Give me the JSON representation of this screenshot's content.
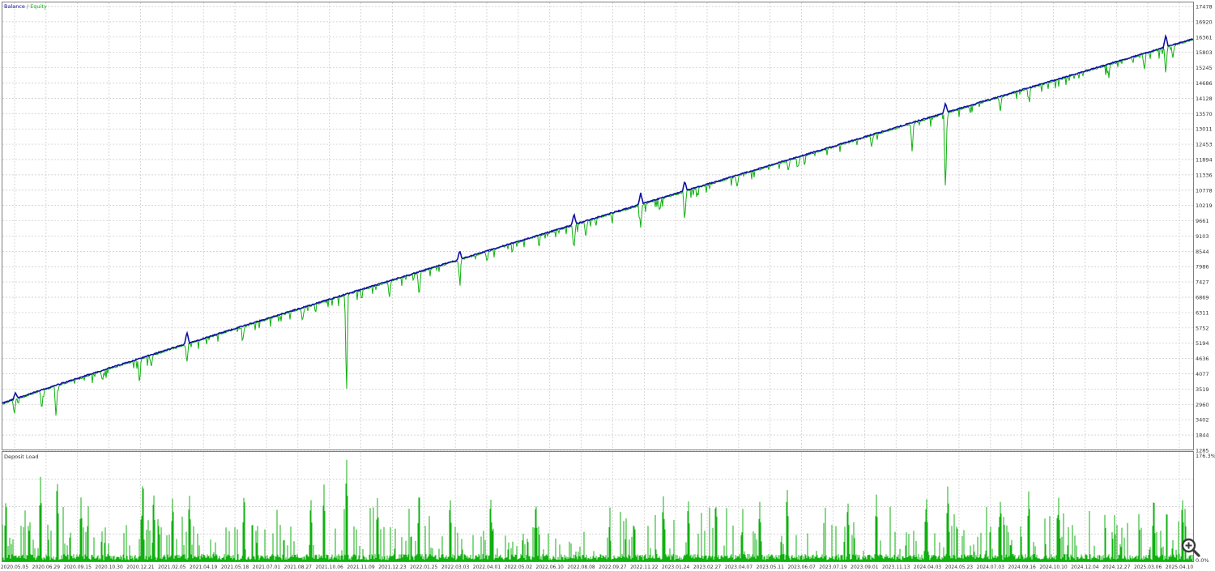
{
  "chart_data": [
    {
      "type": "line",
      "legend": {
        "label_prefix": "Balance",
        "label_separator": " / ",
        "label_suffix": "Equity",
        "placement": "top-left"
      },
      "colors": {
        "balance": "#1010a0",
        "equity": "#10b010",
        "grid": "#c8c8c8",
        "frame": "#7f7f7f",
        "text": "#333333"
      },
      "grid": true,
      "ylim": [
        1285,
        17478
      ],
      "y_ticks": [
        "17478",
        "16920",
        "16361",
        "15803",
        "15245",
        "14686",
        "14128",
        "13570",
        "13011",
        "12453",
        "11894",
        "11336",
        "10778",
        "10219",
        "9661",
        "9103",
        "8544",
        "7986",
        "7427",
        "6869",
        "6311",
        "5752",
        "5194",
        "4636",
        "4077",
        "3519",
        "2960",
        "3402",
        "1844",
        "1285"
      ],
      "x_labels": [
        "2020.05.05",
        "2020.06.29",
        "2020.09.15",
        "2020.10.30",
        "2020.12.21",
        "2021.02.05",
        "2021.04.19",
        "2021.05.18",
        "2021.07.01",
        "2021.08.27",
        "2021.10.06",
        "2021.11.09",
        "2021.12.23",
        "2022.01.25",
        "2022.03.03",
        "2022.04.01",
        "2022.05.02",
        "2022.06.10",
        "2022.08.08",
        "2022.09.27",
        "2022.11.22",
        "2023.01.24",
        "2023.02.27",
        "2023.04.07",
        "2023.05.11",
        "2023.06.07",
        "2023.07.19",
        "2023.09.01",
        "2023.11.13",
        "2024.04.03",
        "2024.05.23",
        "2024.07.03",
        "2024.09.16",
        "2024.10.10",
        "2024.12.04",
        "2024.12.27",
        "2025.03.06",
        "2025.04.10"
      ],
      "series": [
        {
          "name": "Balance",
          "start": 2960,
          "end": 16158
        },
        {
          "name": "Equity",
          "start": 2960,
          "end": 16158
        }
      ],
      "balance_bumps": [
        {
          "pos": 0.011,
          "up": 220
        },
        {
          "pos": 0.155,
          "up": 420
        },
        {
          "pos": 0.384,
          "up": 300
        },
        {
          "pos": 0.48,
          "up": 380
        },
        {
          "pos": 0.536,
          "up": 420
        },
        {
          "pos": 0.573,
          "up": 350
        },
        {
          "pos": 0.792,
          "up": 350
        },
        {
          "pos": 0.977,
          "up": 420
        }
      ],
      "equity_drawdowns": [
        {
          "pos": 0.01,
          "depth": 550
        },
        {
          "pos": 0.033,
          "depth": 700
        },
        {
          "pos": 0.045,
          "depth": 1150
        },
        {
          "pos": 0.084,
          "depth": 380
        },
        {
          "pos": 0.115,
          "depth": 820
        },
        {
          "pos": 0.125,
          "depth": 420
        },
        {
          "pos": 0.155,
          "depth": 700
        },
        {
          "pos": 0.202,
          "depth": 420
        },
        {
          "pos": 0.252,
          "depth": 480
        },
        {
          "pos": 0.289,
          "depth": 3700
        },
        {
          "pos": 0.325,
          "depth": 650
        },
        {
          "pos": 0.35,
          "depth": 900
        },
        {
          "pos": 0.384,
          "depth": 750
        },
        {
          "pos": 0.407,
          "depth": 380
        },
        {
          "pos": 0.48,
          "depth": 900
        },
        {
          "pos": 0.49,
          "depth": 600
        },
        {
          "pos": 0.536,
          "depth": 850
        },
        {
          "pos": 0.552,
          "depth": 420
        },
        {
          "pos": 0.573,
          "depth": 1100
        },
        {
          "pos": 0.617,
          "depth": 400
        },
        {
          "pos": 0.66,
          "depth": 380
        },
        {
          "pos": 0.73,
          "depth": 420
        },
        {
          "pos": 0.764,
          "depth": 1050
        },
        {
          "pos": 0.792,
          "depth": 2950
        },
        {
          "pos": 0.838,
          "depth": 550
        },
        {
          "pos": 0.862,
          "depth": 380
        },
        {
          "pos": 0.929,
          "depth": 320
        },
        {
          "pos": 0.959,
          "depth": 600
        },
        {
          "pos": 0.977,
          "depth": 1000
        },
        {
          "pos": 0.983,
          "depth": 450
        }
      ]
    },
    {
      "type": "bar",
      "title": "Deposit Load",
      "colors": {
        "bars": "#10b010"
      },
      "ylim": [
        0,
        176.3
      ],
      "y_ticks": [
        "176.3%",
        "0.0%"
      ],
      "peaks": [
        {
          "pos": 0.003,
          "value": 110
        },
        {
          "pos": 0.032,
          "value": 140
        },
        {
          "pos": 0.046,
          "value": 145
        },
        {
          "pos": 0.066,
          "value": 105
        },
        {
          "pos": 0.118,
          "value": 145
        },
        {
          "pos": 0.127,
          "value": 120
        },
        {
          "pos": 0.143,
          "value": 110
        },
        {
          "pos": 0.157,
          "value": 115
        },
        {
          "pos": 0.203,
          "value": 120
        },
        {
          "pos": 0.259,
          "value": 110
        },
        {
          "pos": 0.27,
          "value": 130
        },
        {
          "pos": 0.289,
          "value": 176
        },
        {
          "pos": 0.315,
          "value": 105
        },
        {
          "pos": 0.35,
          "value": 125
        },
        {
          "pos": 0.376,
          "value": 110
        },
        {
          "pos": 0.41,
          "value": 112
        },
        {
          "pos": 0.448,
          "value": 105
        },
        {
          "pos": 0.555,
          "value": 112
        },
        {
          "pos": 0.576,
          "value": 108
        },
        {
          "pos": 0.599,
          "value": 105
        },
        {
          "pos": 0.636,
          "value": 100
        },
        {
          "pos": 0.659,
          "value": 128
        },
        {
          "pos": 0.71,
          "value": 105
        },
        {
          "pos": 0.734,
          "value": 110
        },
        {
          "pos": 0.776,
          "value": 112
        },
        {
          "pos": 0.794,
          "value": 130
        },
        {
          "pos": 0.838,
          "value": 102
        },
        {
          "pos": 0.862,
          "value": 120
        },
        {
          "pos": 0.887,
          "value": 108
        },
        {
          "pos": 0.967,
          "value": 115
        },
        {
          "pos": 0.991,
          "value": 108
        }
      ]
    }
  ],
  "toolbar": {
    "zoom_icon": "magnifier-plus-icon"
  }
}
